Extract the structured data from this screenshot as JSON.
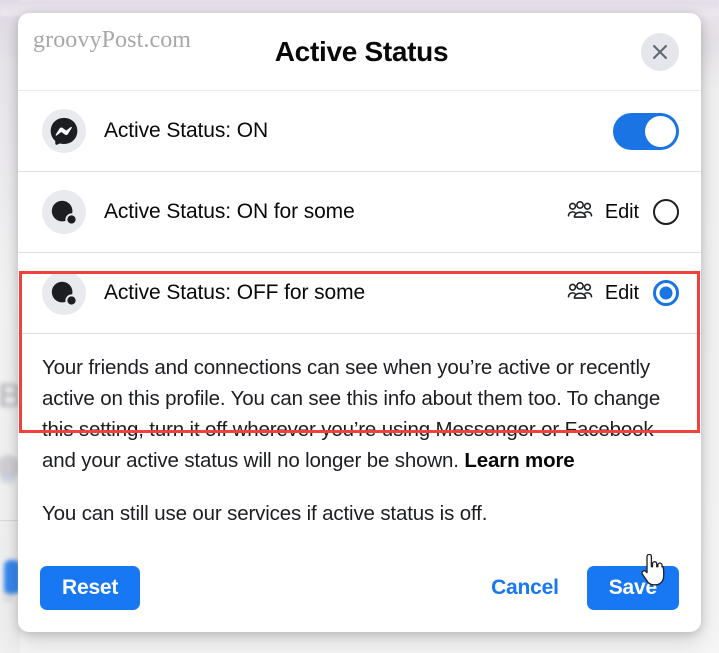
{
  "watermark": "groovyPost.com",
  "dialog": {
    "title": "Active Status",
    "close_icon": "close-x-icon"
  },
  "rows": [
    {
      "id": "active-status-on",
      "icon": "messenger-logo-icon",
      "label": "Active Status: ON",
      "control": "toggle",
      "toggle_on": true,
      "highlighted": false
    },
    {
      "id": "active-status-on-for-some",
      "icon": "active-dot-avatar-icon",
      "label": "Active Status: ON for some",
      "control": "radio",
      "selected": false,
      "edit_label": "Edit",
      "edit_icon": "people-group-icon",
      "highlighted": true
    },
    {
      "id": "active-status-off-for-some",
      "icon": "active-dot-avatar-icon",
      "label": "Active Status: OFF for some",
      "control": "radio",
      "selected": true,
      "edit_label": "Edit",
      "edit_icon": "people-group-icon",
      "highlighted": true
    }
  ],
  "body": {
    "paragraph_1_pre": "Your friends and connections can see when you’re active or recently active on this profile. You can see this info about them too. To change this setting, turn it off wherever you’re using Messenger or Facebook and your active status will no longer be shown. ",
    "learn_more": "Learn more",
    "paragraph_2": "You can still use our services if active status is off."
  },
  "footer": {
    "reset_label": "Reset",
    "cancel_label": "Cancel",
    "save_label": "Save"
  },
  "colors": {
    "accent_blue": "#1877f2",
    "toggle_blue": "#1b74e4",
    "highlight_red": "#f4403c",
    "text_primary": "#1c1e21"
  },
  "cursor": {
    "type": "pointer-hand-cursor"
  }
}
